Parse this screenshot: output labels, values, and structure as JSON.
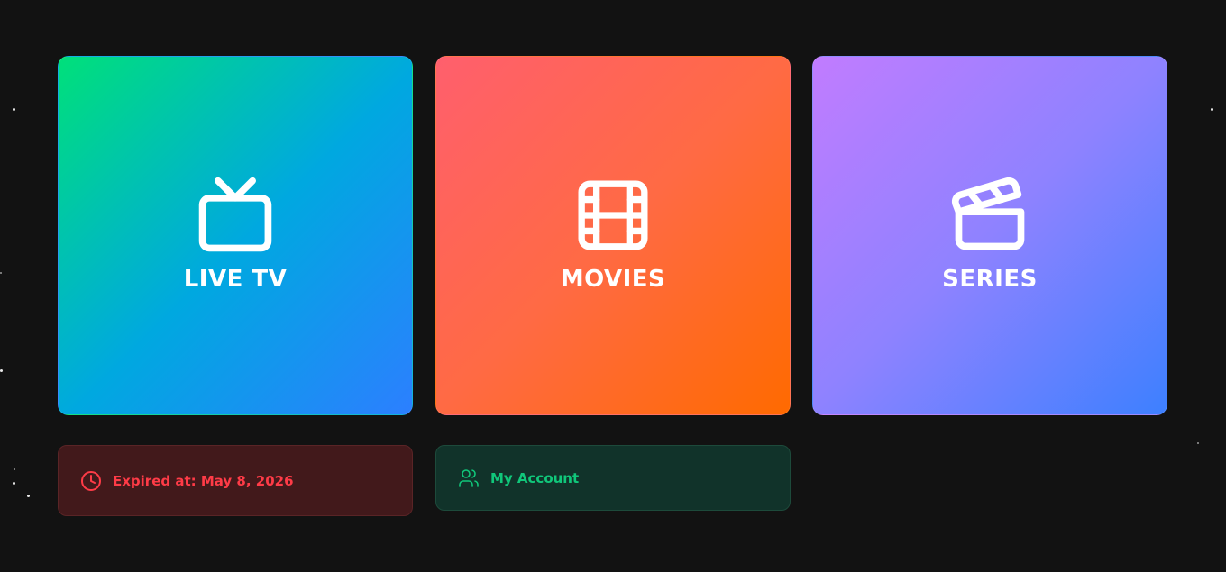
{
  "cards": {
    "live_tv": {
      "label": "LIVE TV",
      "icon": "tv-icon"
    },
    "movies": {
      "label": "MOVIES",
      "icon": "film-icon"
    },
    "series": {
      "label": "SERIES",
      "icon": "clapperboard-icon"
    }
  },
  "expiry": {
    "text": "Expired at: May 8, 2026",
    "icon": "clock-icon",
    "color": "#ff3b47"
  },
  "account": {
    "label": "My Account",
    "icon": "users-icon",
    "color": "#10c77a"
  },
  "colors": {
    "background": "#121212",
    "live_tv_gradient": [
      "#00e07a",
      "#00a8e0",
      "#2c7fff"
    ],
    "movies_gradient": [
      "#ff5f6d",
      "#ff6a44",
      "#ff6a00"
    ],
    "series_gradient": [
      "#c17cff",
      "#8e82ff",
      "#3d80ff"
    ]
  }
}
